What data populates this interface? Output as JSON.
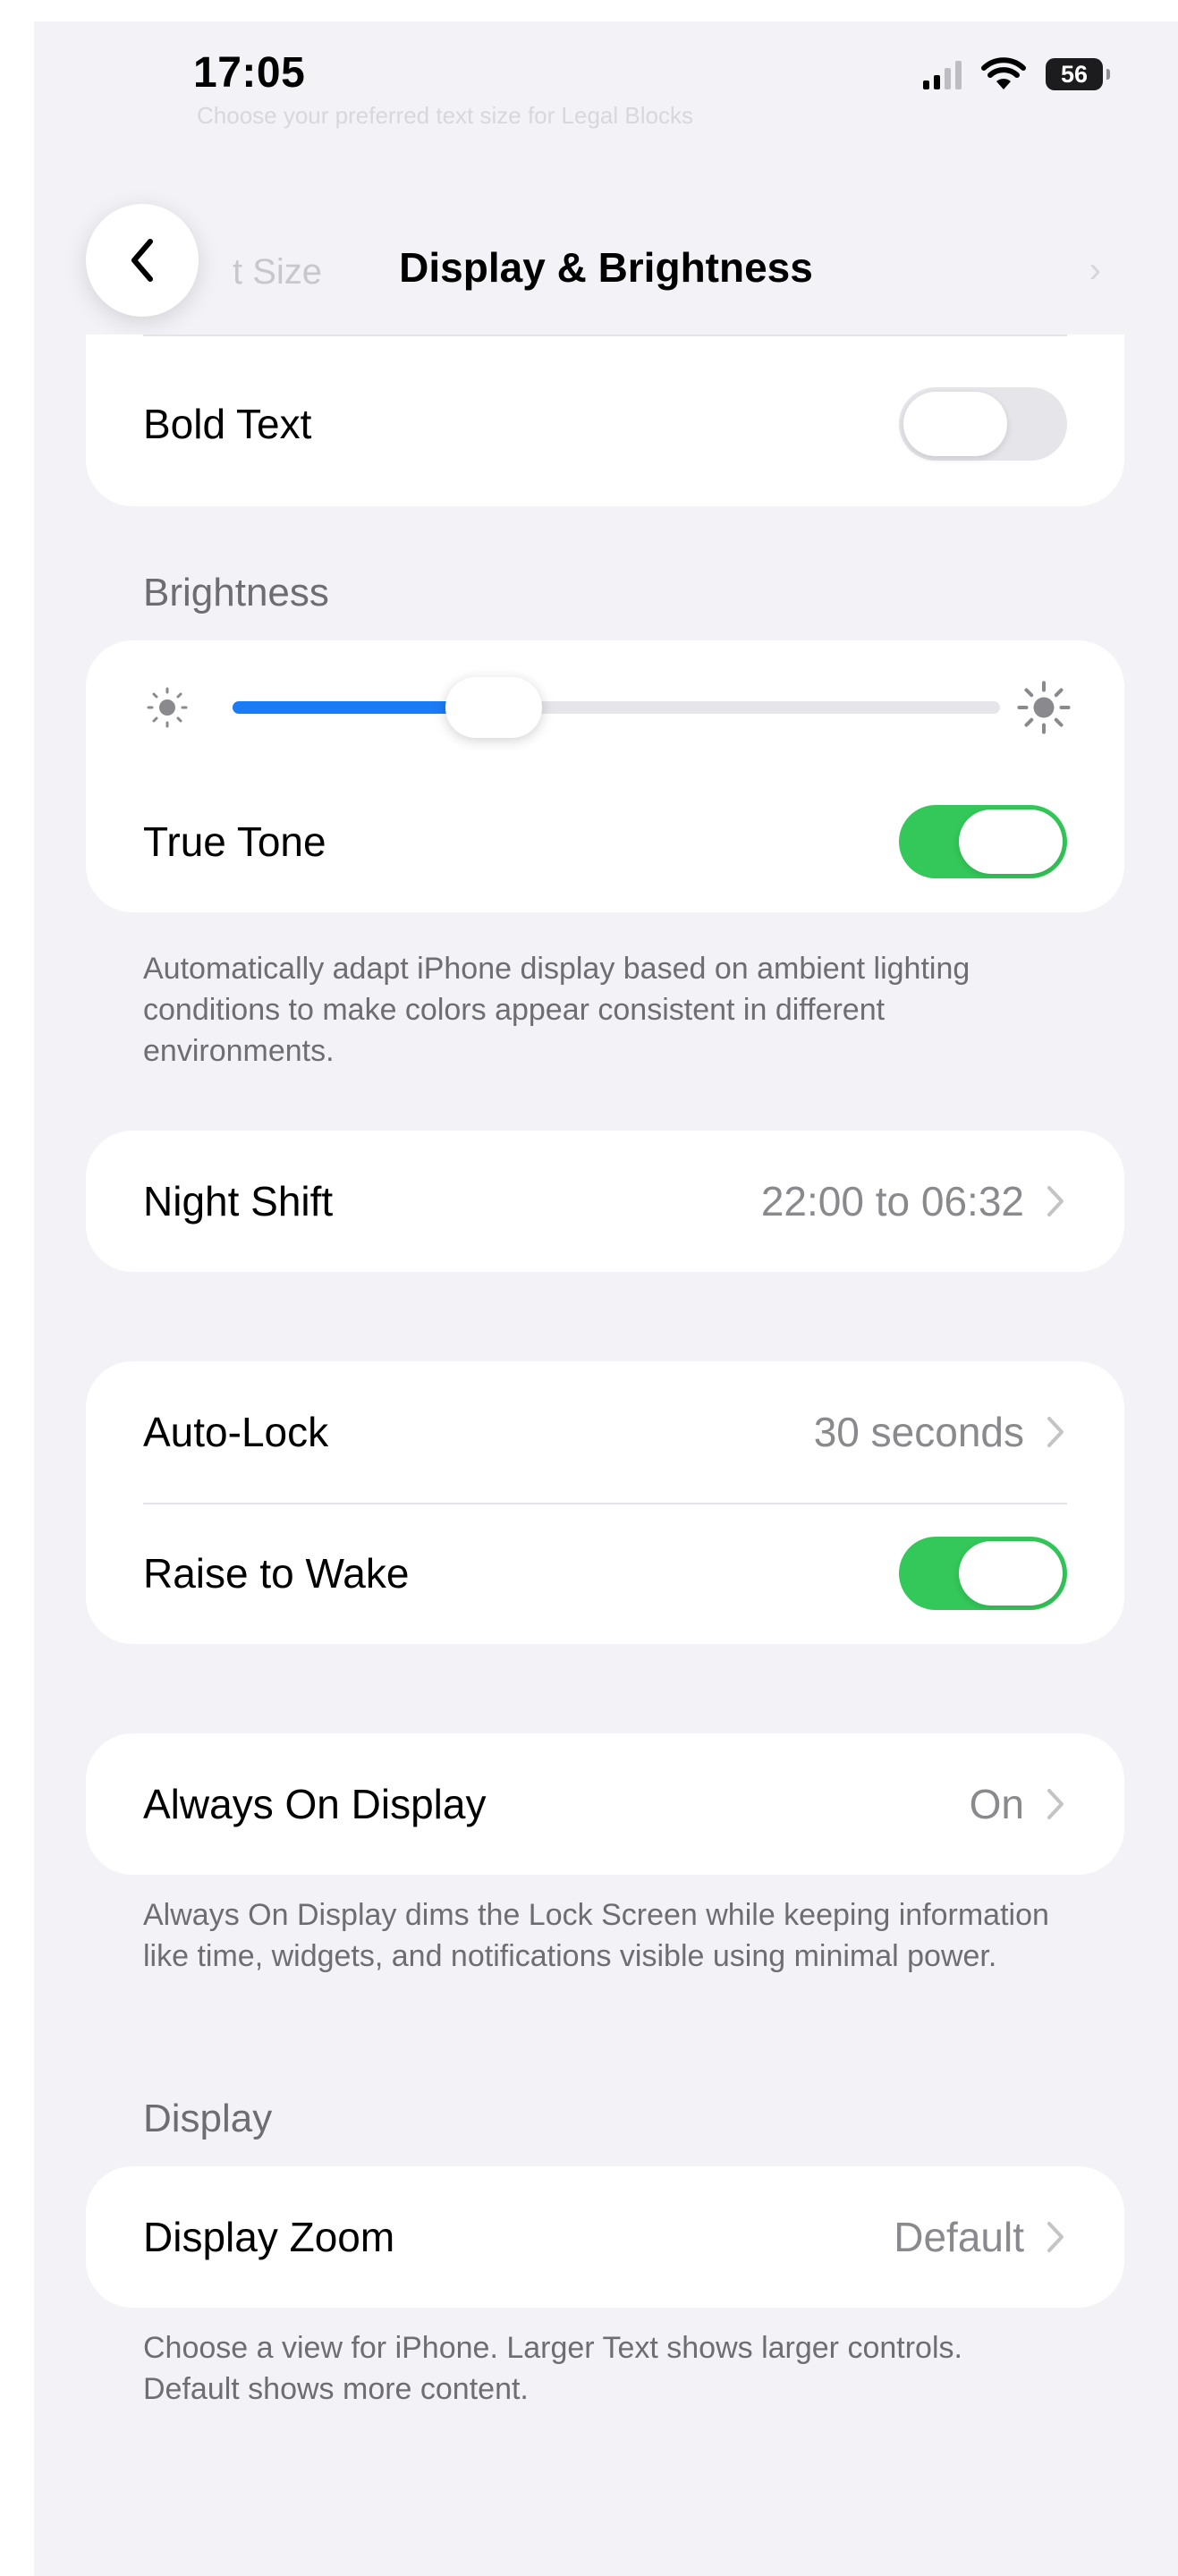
{
  "status_bar": {
    "time": "17:05",
    "battery": "56"
  },
  "nav": {
    "title": "Display & Brightness",
    "ghost_row": "t Size",
    "ghost_top": "Choose your preferred text size for Legal Blocks"
  },
  "bold_text": {
    "label": "Bold Text",
    "enabled": false
  },
  "brightness": {
    "header": "Brightness",
    "level": 0.34,
    "true_tone": {
      "label": "True Tone",
      "enabled": true
    },
    "footer": "Automatically adapt iPhone display based on ambient lighting conditions to make colors appear consistent in different environments."
  },
  "night_shift": {
    "label": "Night Shift",
    "value": "22:00 to 06:32"
  },
  "lock": {
    "auto_lock": {
      "label": "Auto-Lock",
      "value": "30 seconds"
    },
    "raise_to_wake": {
      "label": "Raise to Wake",
      "enabled": true
    }
  },
  "always_on": {
    "label": "Always On Display",
    "value": "On",
    "footer": "Always On Display dims the Lock Screen while keeping information like time, widgets, and notifications visible using minimal power."
  },
  "display": {
    "header": "Display",
    "zoom": {
      "label": "Display Zoom",
      "value": "Default"
    },
    "footer": "Choose a view for iPhone. Larger Text shows larger controls. Default shows more content."
  },
  "colors": {
    "accent_blue": "#1a7cf5",
    "toggle_green": "#34c759",
    "background": "#f2f2f7"
  },
  "icons": [
    "back-chevron-icon",
    "signal-icon",
    "wifi-icon",
    "battery-icon",
    "sun-small-icon",
    "sun-large-icon",
    "chevron-right-icon"
  ]
}
